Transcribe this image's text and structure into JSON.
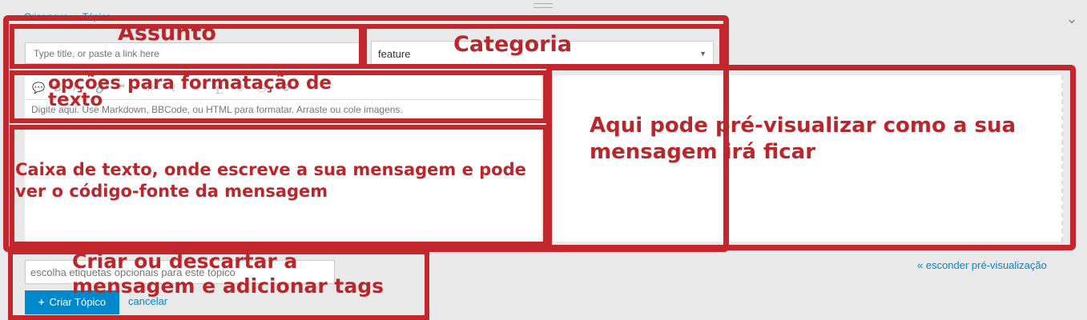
{
  "breadcrumb": {
    "item1": "Criar novo",
    "item2": "Tópico"
  },
  "title_input": {
    "placeholder": "Type title, or paste a link here"
  },
  "category_select": {
    "value": "feature"
  },
  "editor": {
    "help_text": "Digite aqui. Use Markdown, BBCode, ou HTML para formatar. Arraste ou cole imagens."
  },
  "tags_input": {
    "placeholder": "escolha etiquetas opcionais para este tópico"
  },
  "actions": {
    "create_label": "Criar Tópico",
    "create_icon": "plus-icon",
    "cancel_label": "cancelar"
  },
  "preview": {
    "hide_label": "« esconder pré-visualização"
  },
  "annotations": {
    "assunto": "Assunto",
    "categoria": "Categoria",
    "format": "opções para formatação de texto",
    "editor": "Caixa de texto, onde escreve a sua mensagem e pode ver o código-fonte da mensagem",
    "preview": "Aqui pode pré-visualizar como a sua mensagem irá ficar",
    "actions": "Criar ou descartar a mensagem e adicionar tags"
  },
  "colors": {
    "annotation": "#c1272d",
    "primary": "#0088cc",
    "background": "#e9e9e9"
  }
}
